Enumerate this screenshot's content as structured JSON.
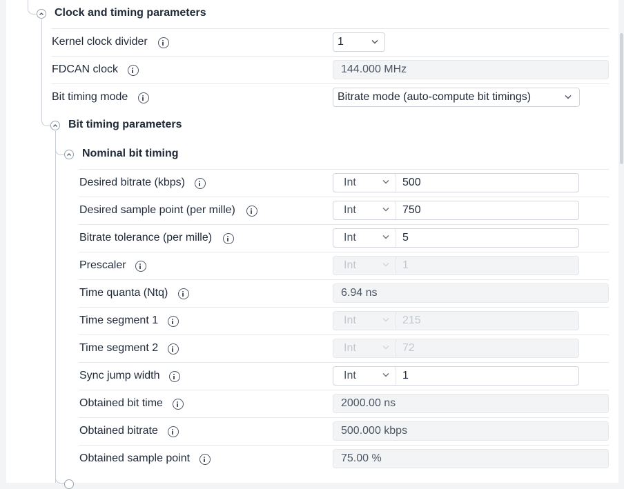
{
  "sections": {
    "clock_timing": {
      "title": "Clock and timing parameters",
      "icon": "chevron-up-icon"
    },
    "bit_timing": {
      "title": "Bit timing parameters",
      "icon": "chevron-up-icon"
    },
    "nominal": {
      "title": "Nominal bit timing",
      "icon": "chevron-up-icon"
    }
  },
  "clock": {
    "kernel_clock_divider": {
      "label": "Kernel clock divider",
      "value": "1"
    },
    "fdcan_clock": {
      "label": "FDCAN clock",
      "value": "144.000 MHz"
    },
    "bit_timing_mode": {
      "label": "Bit timing mode",
      "value": "Bitrate mode (auto-compute bit timings)"
    }
  },
  "nominal": {
    "desired_bitrate": {
      "label": "Desired bitrate (kbps)",
      "type": "Int",
      "value": "500"
    },
    "desired_sample_point": {
      "label": "Desired sample point (per mille)",
      "type": "Int",
      "value": "750"
    },
    "bitrate_tolerance": {
      "label": "Bitrate tolerance (per mille)",
      "type": "Int",
      "value": "5"
    },
    "prescaler": {
      "label": "Prescaler",
      "type": "Int",
      "value": "1"
    },
    "time_quanta": {
      "label": "Time quanta (Ntq)",
      "value": "6.94 ns"
    },
    "time_segment_1": {
      "label": "Time segment 1",
      "type": "Int",
      "value": "215"
    },
    "time_segment_2": {
      "label": "Time segment 2",
      "type": "Int",
      "value": "72"
    },
    "sync_jump_width": {
      "label": "Sync jump width",
      "type": "Int",
      "value": "1"
    },
    "obtained_bit_time": {
      "label": "Obtained bit time",
      "value": "2000.00 ns"
    },
    "obtained_bitrate": {
      "label": "Obtained bitrate",
      "value": "500.000 kbps"
    },
    "obtained_sample_point": {
      "label": "Obtained sample point",
      "value": "75.00 %"
    }
  },
  "icons": {
    "info": "info-icon",
    "dropdown": "chevron-down-icon"
  }
}
